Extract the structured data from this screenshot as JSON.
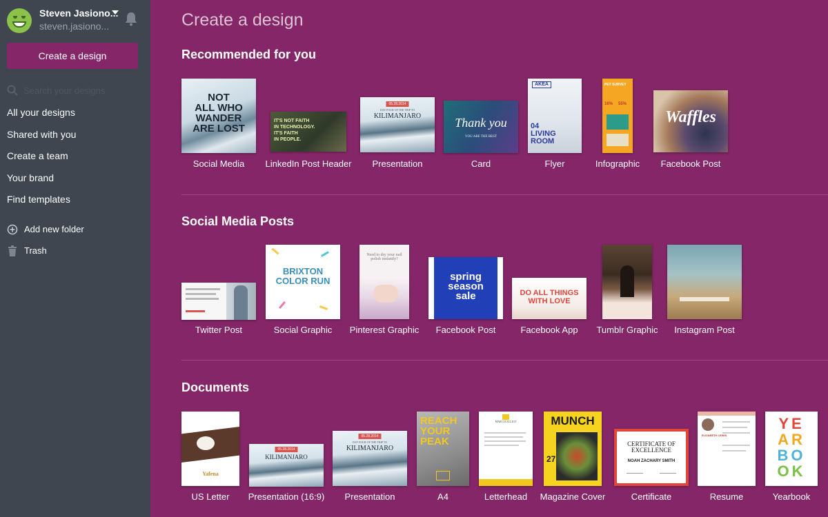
{
  "user": {
    "name": "Steven Jasiono...",
    "email": "steven.jasiono..."
  },
  "sidebar": {
    "create_button": "Create a design",
    "search_placeholder": "Search your designs",
    "nav": [
      "All your designs",
      "Shared with you",
      "Create a team",
      "Your brand",
      "Find templates"
    ],
    "add_folder": "Add new folder",
    "trash": "Trash"
  },
  "main": {
    "title": "Create a design",
    "sections": [
      {
        "title": "Recommended for you",
        "items": [
          "Social Media",
          "LinkedIn Post Header",
          "Presentation",
          "Card",
          "Flyer",
          "Infographic",
          "Facebook Post"
        ]
      },
      {
        "title": "Social Media Posts",
        "items": [
          "Twitter Post",
          "Social Graphic",
          "Pinterest Graphic",
          "Facebook Post",
          "Facebook App",
          "Tumblr Graphic",
          "Instagram Post"
        ]
      },
      {
        "title": "Documents",
        "items": [
          "US Letter",
          "Presentation (16:9)",
          "Presentation",
          "A4",
          "Letterhead",
          "Magazine Cover",
          "Certificate",
          "Resume",
          "Yearbook"
        ]
      }
    ]
  },
  "thumbs": {
    "social_media": [
      "NOT",
      "ALL WHO",
      "WANDER",
      "ARE LOST"
    ],
    "linkedin": [
      "IT'S NOT FAITH",
      "IN TECHNOLOGY.",
      "IT'S FAITH",
      "IN PEOPLE."
    ],
    "kilimanjaro_date": "05.28.2014",
    "kilimanjaro_sub": "DAY FOUR OF THE TRIP TO",
    "kilimanjaro": "KILIMANJARO",
    "card_script": "Thank you",
    "card_sub": "YOU ARE THE BEST",
    "flyer_brand": "AKEA",
    "flyer_lines": [
      "04",
      "LIVING",
      "ROOM"
    ],
    "infographic_title": "PET SURVEY",
    "infographic_stats": [
      "16%",
      "55%"
    ],
    "waffles": "Waffles",
    "brixton": [
      "BRIXTON",
      "COLOR RUN"
    ],
    "pinterest_text": [
      "Need to dry your nail",
      "polish instantly?"
    ],
    "spring": [
      "spring",
      "season",
      "sale"
    ],
    "do_all": [
      "DO ALL THINGS",
      "WITH LOVE"
    ],
    "reach": [
      "REACH",
      "YOUR",
      "PEAK"
    ],
    "munch": "MUNCH",
    "munch_num": "27",
    "certificate": [
      "CERTIFICATE OF",
      "EXCELLENCE"
    ],
    "certificate_name": "NOAH ZACHARY SMITH",
    "yearbook": [
      "YE",
      "AR",
      "BO",
      "OK"
    ],
    "us_letter_brand": "Yafena",
    "letterhead_name": "MARCIA ELLIOT",
    "resume_name": "ELIZABETH LEWIS"
  },
  "colors": {
    "sidebar": "#3f4650",
    "main": "#842667",
    "accent": "#842667",
    "avatar": "#8bc34a"
  },
  "icons": {
    "bell": "bell-icon",
    "search": "search-icon",
    "add_folder": "plus-circle-icon",
    "trash": "trash-icon",
    "user_menu": "caret-down-icon"
  }
}
